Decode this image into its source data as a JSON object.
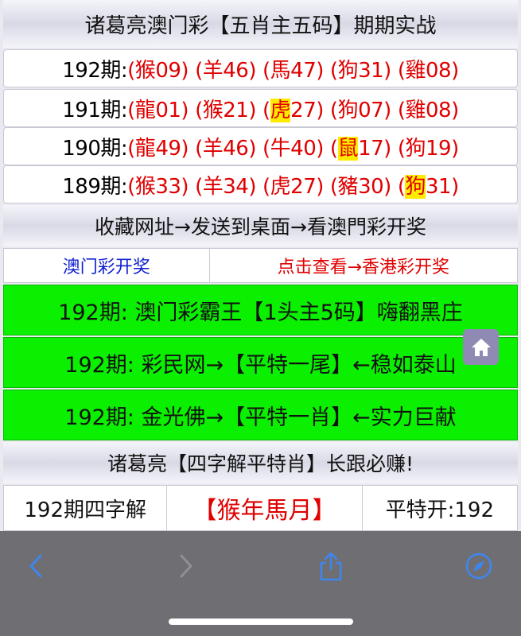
{
  "header": {
    "title": "诸葛亮澳门彩【五肖主五码】期期实战"
  },
  "draws": [
    {
      "period": "192期:",
      "items": [
        {
          "open": "(",
          "z": "猴",
          "n": "09",
          "close": ")",
          "hl": false
        },
        {
          "open": "(",
          "z": "羊",
          "n": "46",
          "close": ")",
          "hl": false
        },
        {
          "open": "(",
          "z": "馬",
          "n": "47",
          "close": ")",
          "hl": false
        },
        {
          "open": "(",
          "z": "狗",
          "n": "31",
          "close": ")",
          "hl": false
        },
        {
          "open": "(",
          "z": "雞",
          "n": "08",
          "close": ")",
          "hl": false
        }
      ]
    },
    {
      "period": "191期:",
      "items": [
        {
          "open": "(",
          "z": "龍",
          "n": "01",
          "close": ")",
          "hl": false
        },
        {
          "open": "(",
          "z": "猴",
          "n": "21",
          "close": ")",
          "hl": false
        },
        {
          "open": "(",
          "z": "虎",
          "n": "27",
          "close": ")",
          "hl": true
        },
        {
          "open": "(",
          "z": "狗",
          "n": "07",
          "close": ")",
          "hl": false
        },
        {
          "open": "(",
          "z": "雞",
          "n": "08",
          "close": ")",
          "hl": false
        }
      ]
    },
    {
      "period": "190期:",
      "items": [
        {
          "open": "(",
          "z": "龍",
          "n": "49",
          "close": ")",
          "hl": false
        },
        {
          "open": "(",
          "z": "羊",
          "n": "46",
          "close": ")",
          "hl": false
        },
        {
          "open": "(",
          "z": "牛",
          "n": "40",
          "close": ")",
          "hl": false
        },
        {
          "open": "(",
          "z": "鼠",
          "n": "17",
          "close": ")",
          "hl": true
        },
        {
          "open": "(",
          "z": "狗",
          "n": "19",
          "close": ")",
          "hl": false
        }
      ]
    },
    {
      "period": "189期:",
      "items": [
        {
          "open": "(",
          "z": "猴",
          "n": "33",
          "close": ")",
          "hl": false
        },
        {
          "open": "(",
          "z": "羊",
          "n": "34",
          "close": ")",
          "hl": false
        },
        {
          "open": "(",
          "z": "虎",
          "n": "27",
          "close": ")",
          "hl": false
        },
        {
          "open": "(",
          "z": "豬",
          "n": "30",
          "close": ")",
          "hl": false
        },
        {
          "open": "(",
          "z": "狗",
          "n": "31",
          "close": ")",
          "hl": true
        }
      ]
    }
  ],
  "bookmark_banner": "收藏网址→发送到桌面→看澳門彩开奖",
  "links": {
    "macau": "澳门彩开奖",
    "hongkong": "点击查看→香港彩开奖"
  },
  "promos": [
    "192期: 澳门彩霸王【1头主5码】嗨翻黑庄",
    "192期: 彩民网→【平特一尾】←稳如泰山",
    "192期: 金光佛→【平特一肖】←实力巨献"
  ],
  "section2_title": "诸葛亮【四字解平特肖】长跟必赚!",
  "four_char": {
    "label": "192期四字解",
    "phrase": "【猴年馬月】",
    "result": "平特开:192"
  },
  "icons": {
    "home": "home-icon",
    "back": "chevron-left-icon",
    "forward": "chevron-right-icon",
    "share": "share-icon",
    "compass": "compass-icon"
  },
  "colors": {
    "accent_blue": "#1a73e8",
    "zodiac_red": "#e00000",
    "highlight": "#ffeb00",
    "green_banner": "#0af000"
  }
}
